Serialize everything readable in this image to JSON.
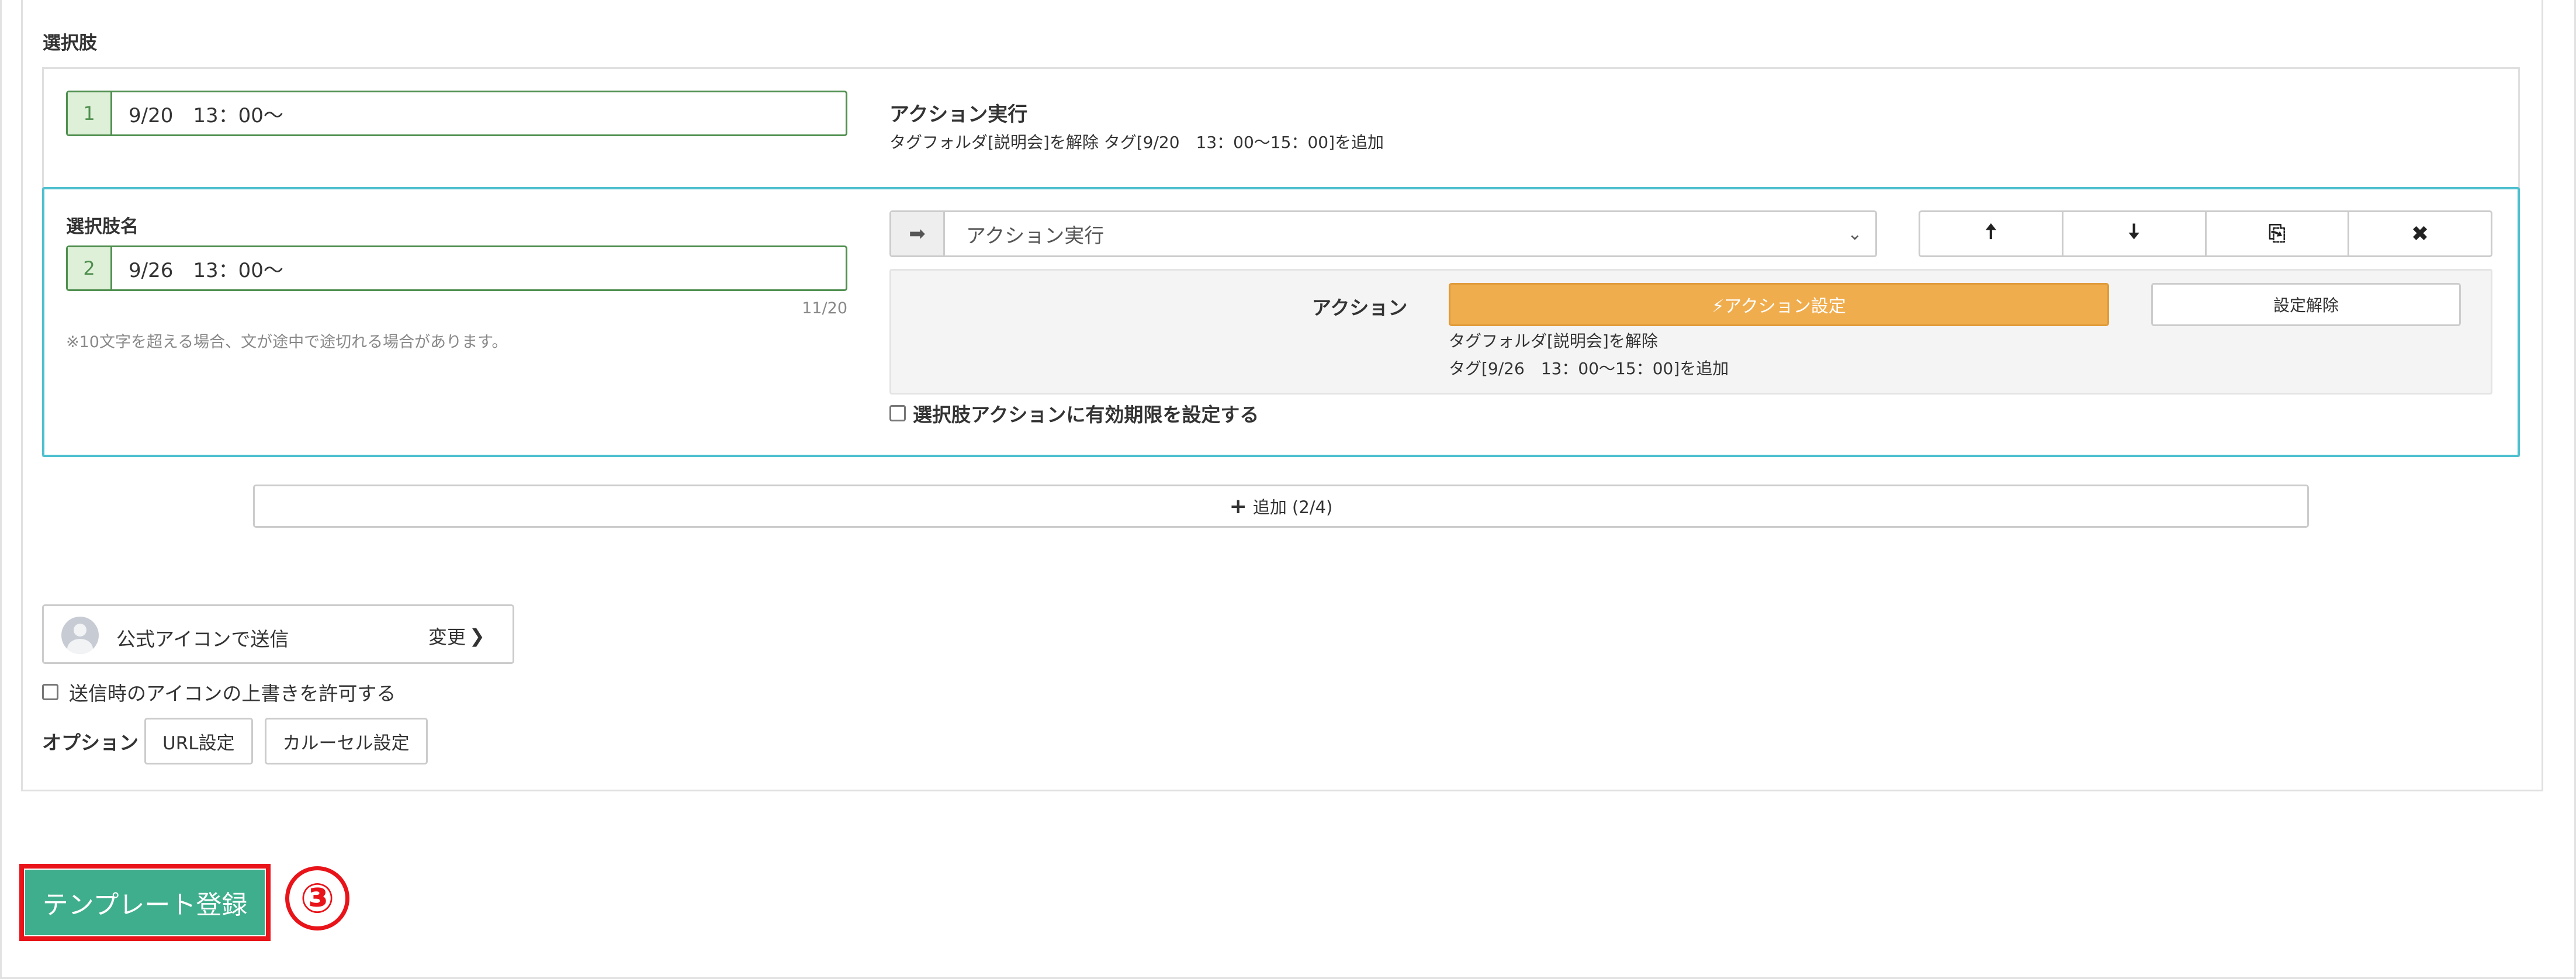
{
  "section": {
    "title": "選択肢"
  },
  "choice1": {
    "number": "1",
    "value": "9/20　13：00～",
    "action_title": "アクション実行",
    "action_desc": "タグフォルダ[説明会]を解除 タグ[9/20　13：00～15：00]を追加"
  },
  "choice2": {
    "label": "選択肢名",
    "number": "2",
    "value": "9/26　13：00～",
    "char_count": "11/20",
    "note": "※10文字を超える場合、文が途中で途切れる場合があります。",
    "select_value": "アクション実行",
    "group_buttons": {
      "up": "🠅",
      "down": "🠇",
      "copy": "⎘",
      "delete": "✖"
    },
    "action_label": "アクション",
    "action_button": "⚡アクション設定",
    "clear_button": "設定解除",
    "action_desc1": "タグフォルダ[説明会]を解除",
    "action_desc2": "タグ[9/26　13：00～15：00]を追加",
    "expiry_label": "選択肢アクションに有効期限を設定する"
  },
  "add_button": {
    "label": "追加 (2/4)"
  },
  "sender": {
    "label": "公式アイコンで送信",
    "change": "変更"
  },
  "override": {
    "label": "送信時のアイコンの上書きを許可する"
  },
  "options": {
    "label": "オプション",
    "buttons": [
      "URL設定",
      "カルーセル設定"
    ]
  },
  "register": {
    "label": "テンプレート登録",
    "step": "③"
  },
  "colors": {
    "active_border": "#4ec0cf",
    "field_green": "#4f8f4f",
    "action_orange": "#f0ad4e",
    "register_green": "#3fae8c",
    "highlight_red": "#e8141a"
  }
}
